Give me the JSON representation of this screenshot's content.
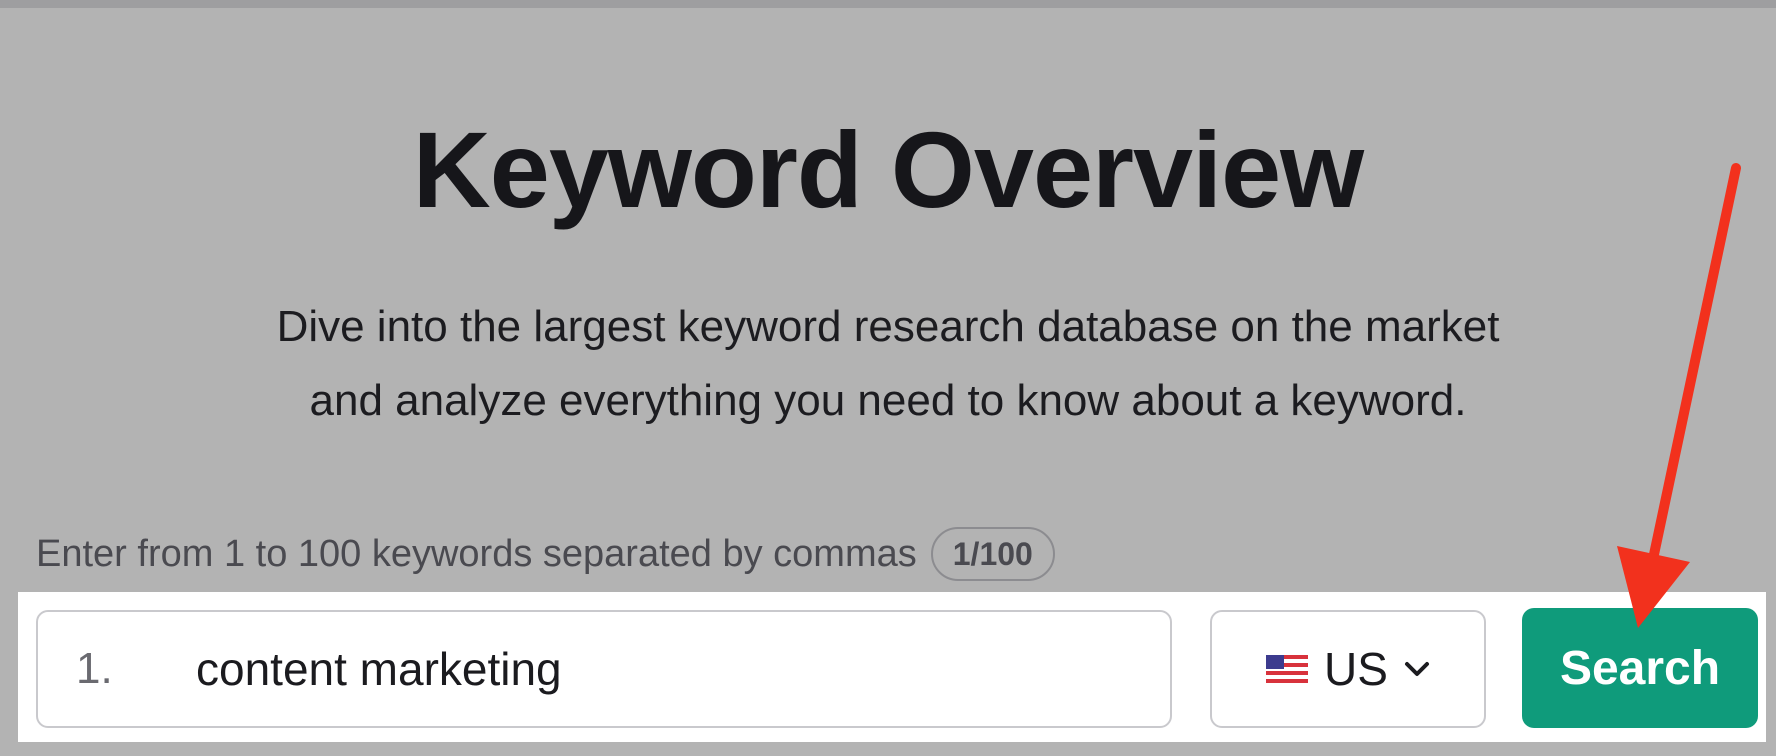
{
  "page": {
    "title": "Keyword Overview",
    "subtitle_line1": "Dive into the largest keyword research database on the market",
    "subtitle_line2": "and analyze everything you need to know about a keyword."
  },
  "search_form": {
    "hint": "Enter from 1 to 100 keywords separated by commas",
    "counter": "1/100",
    "line_number": "1.",
    "keyword_value": "content marketing",
    "country": {
      "selected": "US",
      "flag_icon": "us-flag-icon",
      "dropdown_icon": "chevron-down-icon"
    },
    "search_label": "Search"
  },
  "annotation": {
    "arrow_icon": "red-arrow-icon",
    "color": "#f2311d"
  },
  "colors": {
    "background": "#b3b3b3",
    "search_button": "#0f9b7b",
    "panel": "#ffffff"
  }
}
